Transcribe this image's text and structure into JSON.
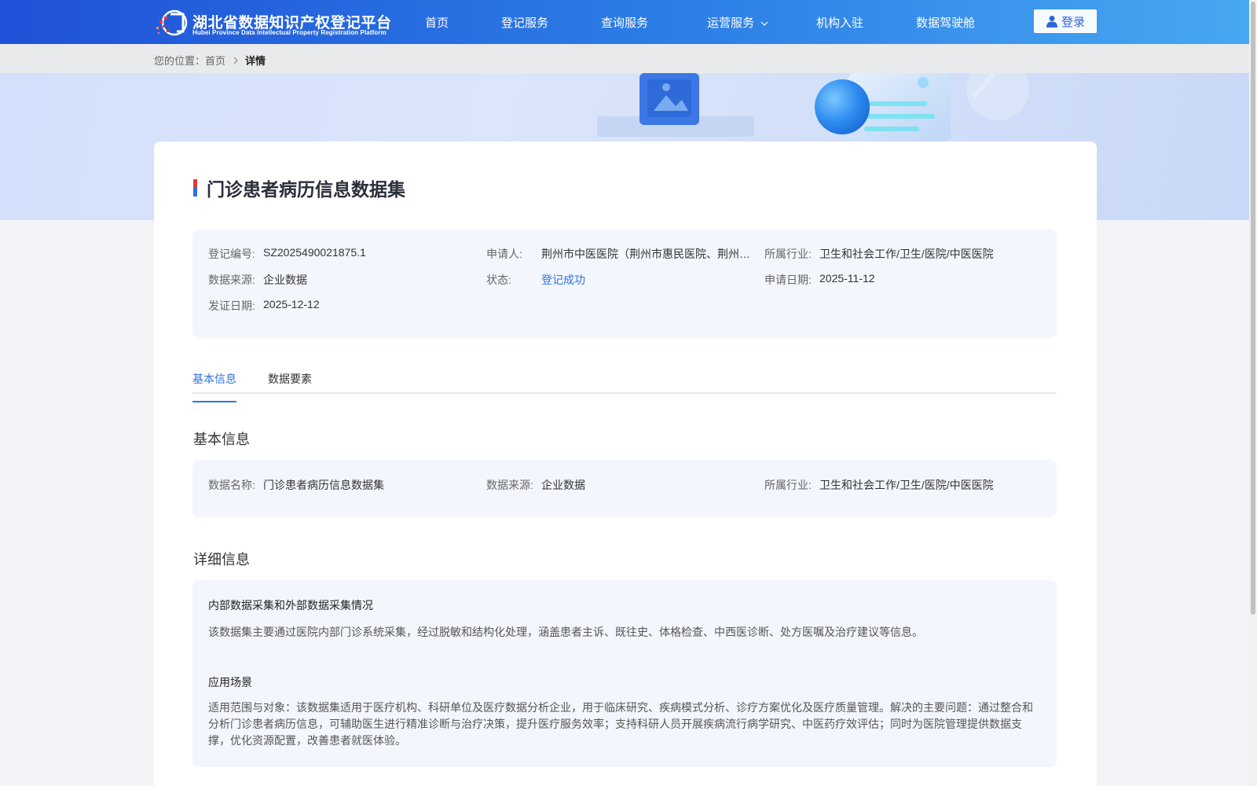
{
  "header": {
    "logo_title": "湖北省数据知识产权登记平台",
    "logo_subtitle": "Hubei Province Data Intellectual Property Registration Platform",
    "nav": {
      "home": "首页",
      "registration": "登记服务",
      "query": "查询服务",
      "operation": "运营服务",
      "institution": "机构入驻",
      "cockpit": "数据驾驶舱"
    },
    "login_label": "登录"
  },
  "breadcrumb": {
    "prefix": "您的位置：",
    "home": "首页",
    "current": "详情"
  },
  "dataset": {
    "title": "门诊患者病历信息数据集",
    "summary": {
      "reg_no_label": "登记编号:",
      "reg_no": "SZ2025490021875.1",
      "applicant_label": "申请人:",
      "applicant": "荆州市中医医院（荆州市惠民医院、荆州…",
      "industry_label": "所属行业:",
      "industry": "卫生和社会工作/卫生/医院/中医医院",
      "source_label": "数据来源:",
      "source": "企业数据",
      "status_label": "状态:",
      "status": "登记成功",
      "apply_date_label": "申请日期:",
      "apply_date": "2025-11-12",
      "cert_date_label": "发证日期:",
      "cert_date": "2025-12-12"
    }
  },
  "tabs": {
    "basic": "基本信息",
    "elements": "数据要素"
  },
  "basic_section": {
    "title": "基本信息",
    "name_label": "数据名称:",
    "name": "门诊患者病历信息数据集",
    "source_label": "数据来源:",
    "source": "企业数据",
    "industry_label": "所属行业:",
    "industry": "卫生和社会工作/卫生/医院/中医医院"
  },
  "detail_section": {
    "title": "详细信息",
    "collection_head": "内部数据采集和外部数据采集情况",
    "collection_text": "该数据集主要通过医院内部门诊系统采集，经过脱敏和结构化处理，涵盖患者主诉、既往史、体格检查、中西医诊断、处方医嘱及治疗建议等信息。",
    "scenario_head": "应用场景",
    "scenario_text": "适用范围与对象：该数据集适用于医疗机构、科研单位及医疗数据分析企业，用于临床研究、疾病模式分析、诊疗方案优化及医疗质量管理。解决的主要问题：通过整合和分析门诊患者病历信息，可辅助医生进行精准诊断与治疗决策，提升医疗服务效率；支持科研人员开展疾病流行病学研究、中医药疗效评估；同时为医院管理提供数据支撑，优化资源配置，改善患者就医体验。"
  },
  "colors": {
    "header_start": "#1f51d8",
    "header_end": "#47a8f2",
    "accent": "#2f73e0",
    "panel_bg": "#f3f6fd"
  },
  "icons": [
    "logo-mark-icon",
    "chevron-down-icon",
    "user-icon",
    "chevron-right-icon"
  ]
}
